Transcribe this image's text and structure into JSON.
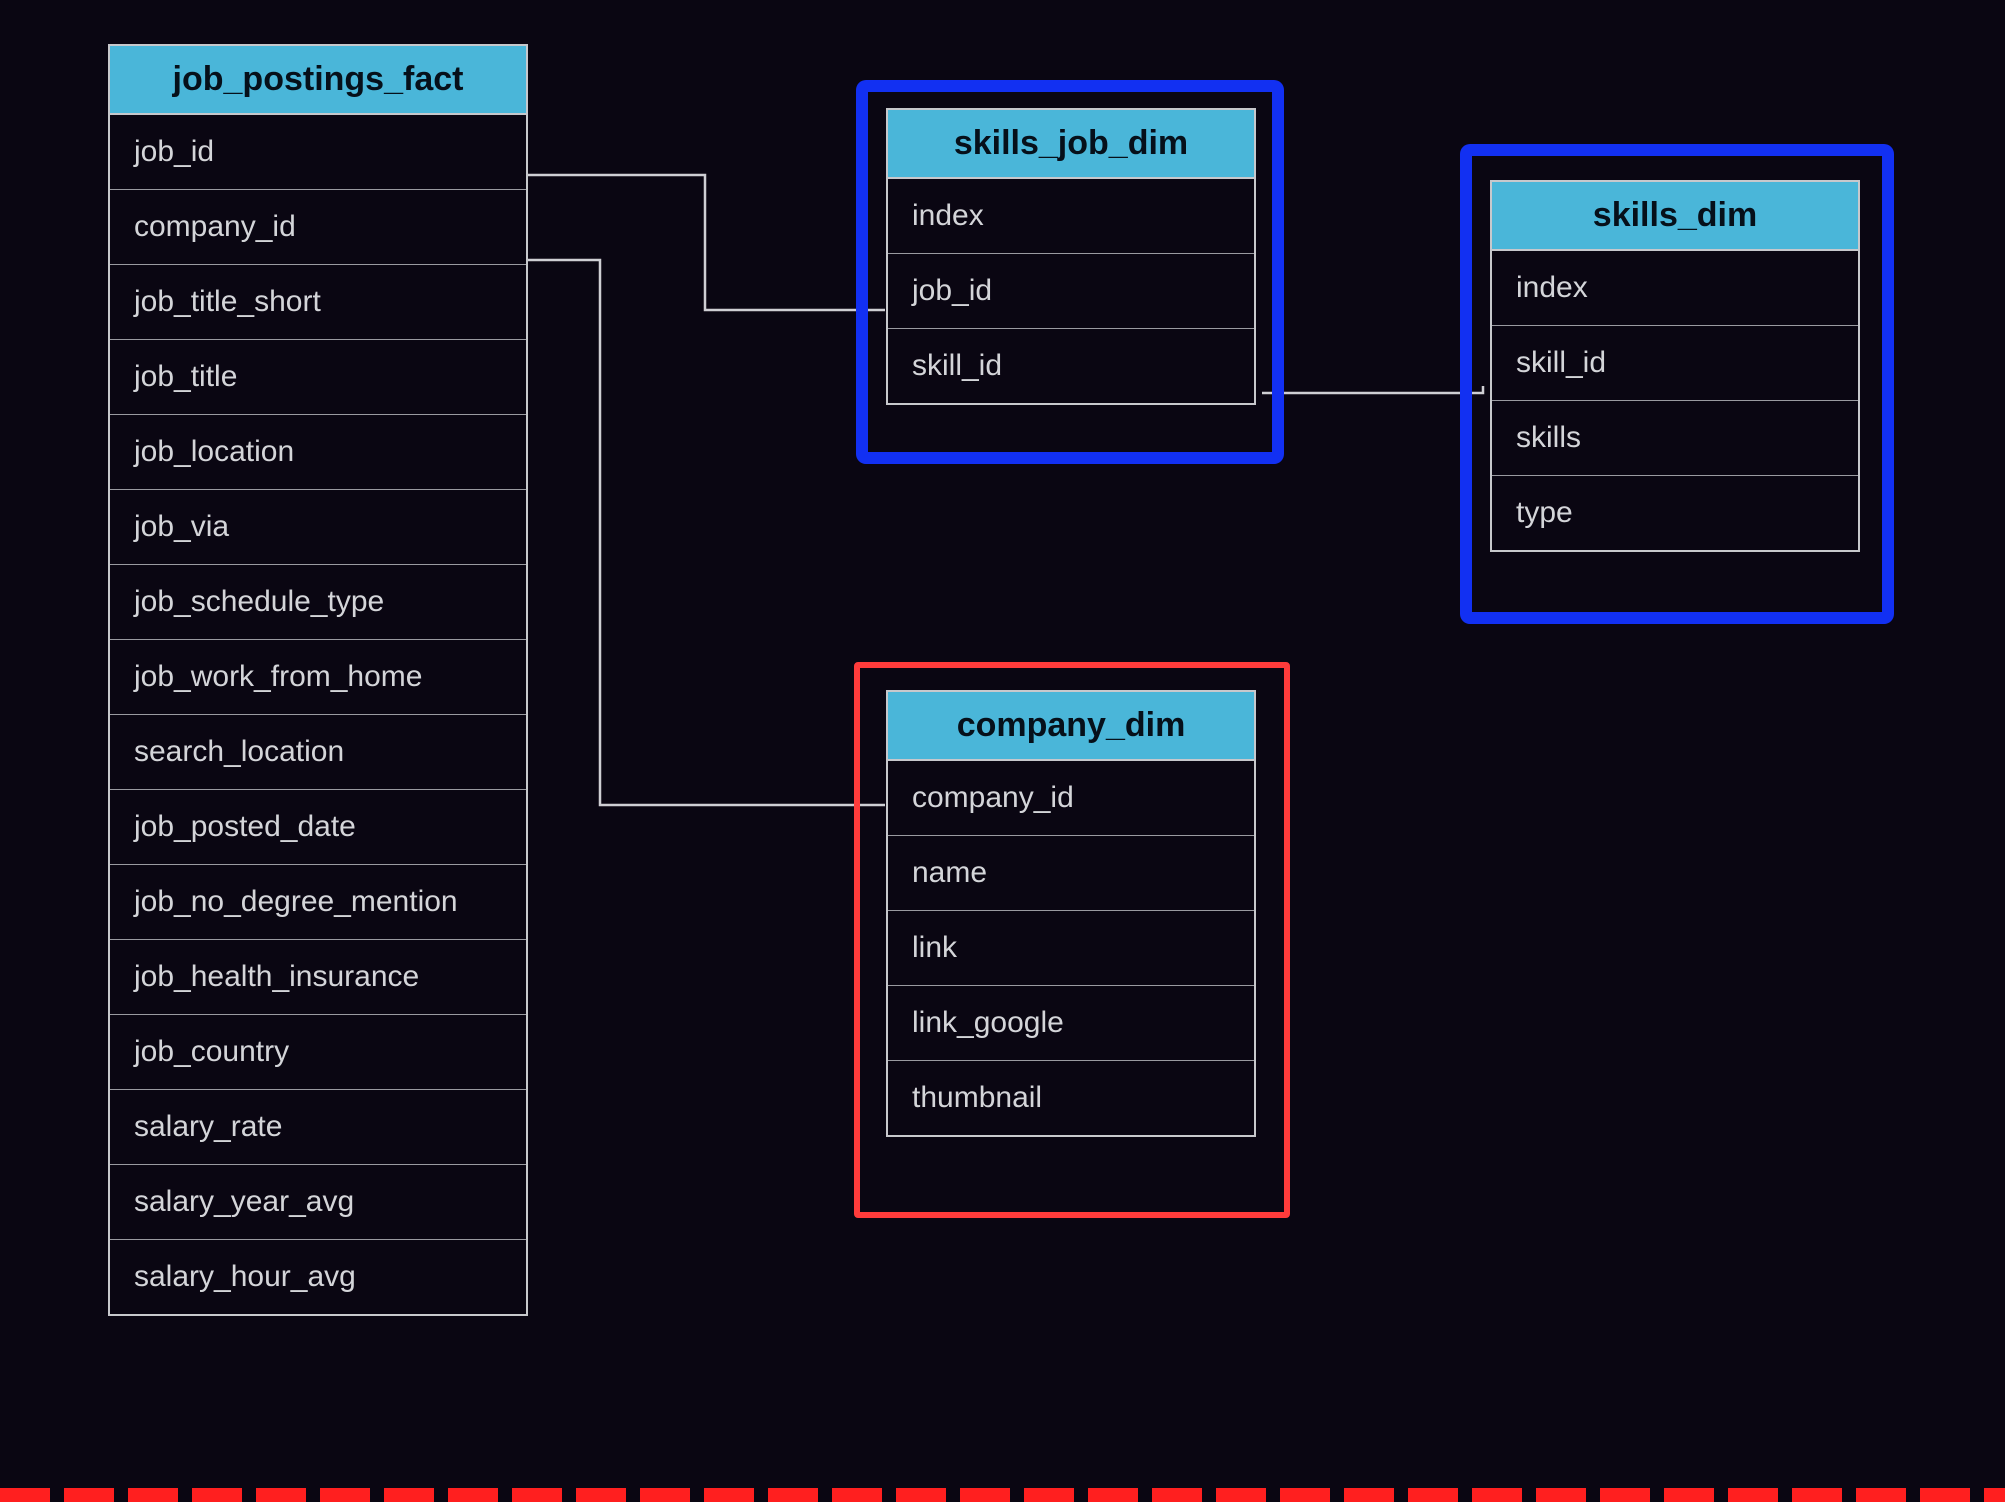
{
  "colors": {
    "header": "#4ab6d9",
    "highlight_blue": "#1230f2",
    "highlight_red": "#ff3b3b",
    "background": "#0a0612",
    "text": "#d4d5d9"
  },
  "tables": {
    "job_postings_fact": {
      "title": "job_postings_fact",
      "fields": [
        "job_id",
        "company_id",
        "job_title_short",
        "job_title",
        "job_location",
        "job_via",
        "job_schedule_type",
        "job_work_from_home",
        "search_location",
        "job_posted_date",
        "job_no_degree_mention",
        "job_health_insurance",
        "job_country",
        "salary_rate",
        "salary_year_avg",
        "salary_hour_avg"
      ]
    },
    "skills_job_dim": {
      "title": "skills_job_dim",
      "fields": [
        "index",
        "job_id",
        "skill_id"
      ]
    },
    "skills_dim": {
      "title": "skills_dim",
      "fields": [
        "index",
        "skill_id",
        "skills",
        "type"
      ]
    },
    "company_dim": {
      "title": "company_dim",
      "fields": [
        "company_id",
        "name",
        "link",
        "link_google",
        "thumbnail"
      ]
    }
  },
  "relationships": [
    {
      "from": "job_postings_fact.job_id",
      "to": "skills_job_dim.job_id"
    },
    {
      "from": "skills_job_dim.skill_id",
      "to": "skills_dim.skill_id"
    },
    {
      "from": "job_postings_fact.company_id",
      "to": "company_dim.company_id"
    }
  ]
}
